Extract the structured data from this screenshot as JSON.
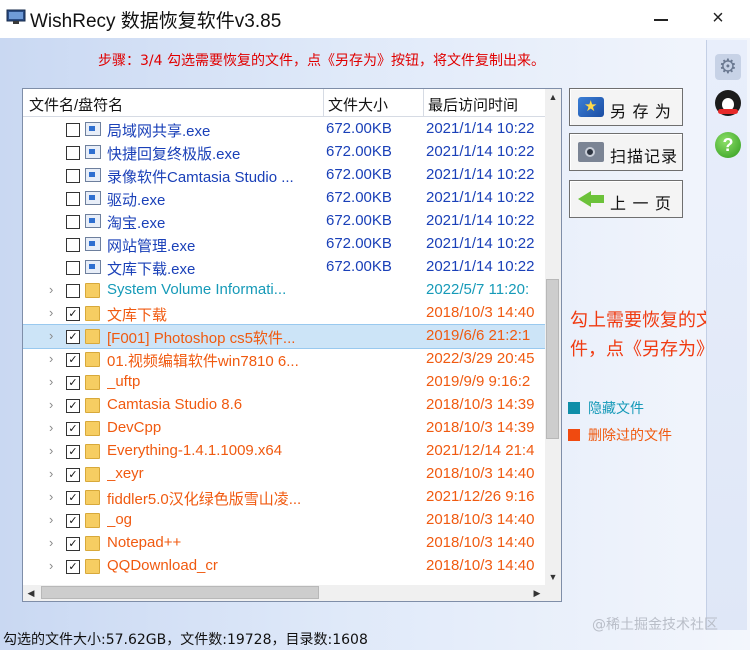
{
  "window": {
    "title": "WishRecy 数据恢复软件v3.85",
    "minimize_glyph": "",
    "close_glyph": "×"
  },
  "step_text": "步骤：3/4 勾选需要恢复的文件，点《另存为》按钮，将文件复制出来。",
  "list": {
    "columns": [
      "文件名/盘符名",
      "文件大小",
      "最后访问时间"
    ],
    "rows": [
      {
        "name": "局域网共享.exe",
        "size": "672.00KB",
        "date": "2021/1/14 10:22",
        "type": "file",
        "color": "normal",
        "checked": false,
        "expandable": false
      },
      {
        "name": "快捷回复终极版.exe",
        "size": "672.00KB",
        "date": "2021/1/14 10:22",
        "type": "file",
        "color": "normal",
        "checked": false,
        "expandable": false
      },
      {
        "name": "录像软件Camtasia Studio ...",
        "size": "672.00KB",
        "date": "2021/1/14 10:22",
        "type": "file",
        "color": "normal",
        "checked": false,
        "expandable": false
      },
      {
        "name": "驱动.exe",
        "size": "672.00KB",
        "date": "2021/1/14 10:22",
        "type": "file",
        "color": "normal",
        "checked": false,
        "expandable": false
      },
      {
        "name": "淘宝.exe",
        "size": "672.00KB",
        "date": "2021/1/14 10:22",
        "type": "file",
        "color": "normal",
        "checked": false,
        "expandable": false
      },
      {
        "name": "网站管理.exe",
        "size": "672.00KB",
        "date": "2021/1/14 10:22",
        "type": "file",
        "color": "normal",
        "checked": false,
        "expandable": false
      },
      {
        "name": "文库下载.exe",
        "size": "672.00KB",
        "date": "2021/1/14 10:22",
        "type": "file",
        "color": "normal",
        "checked": false,
        "expandable": false
      },
      {
        "name": "System Volume Informati...",
        "size": "",
        "date": "2022/5/7 11:20:",
        "type": "folder",
        "color": "hidden",
        "checked": false,
        "expandable": true
      },
      {
        "name": "文库下载",
        "size": "",
        "date": "2018/10/3 14:40",
        "type": "folder",
        "color": "deleted",
        "checked": true,
        "expandable": true
      },
      {
        "name": "[F001] Photoshop cs5软件...",
        "size": "",
        "date": "2019/6/6 21:2:1",
        "type": "folder",
        "color": "deleted",
        "checked": true,
        "expandable": true,
        "selected": true
      },
      {
        "name": "01.视频编辑软件win7810 6...",
        "size": "",
        "date": "2022/3/29 20:45",
        "type": "folder",
        "color": "deleted",
        "checked": true,
        "expandable": true
      },
      {
        "name": "_uftp",
        "size": "",
        "date": "2019/9/9 9:16:2",
        "type": "folder",
        "color": "deleted",
        "checked": true,
        "expandable": true
      },
      {
        "name": "Camtasia Studio 8.6",
        "size": "",
        "date": "2018/10/3 14:39",
        "type": "folder",
        "color": "deleted",
        "checked": true,
        "expandable": true
      },
      {
        "name": "DevCpp",
        "size": "",
        "date": "2018/10/3 14:39",
        "type": "folder",
        "color": "deleted",
        "checked": true,
        "expandable": true
      },
      {
        "name": "Everything-1.4.1.1009.x64",
        "size": "",
        "date": "2021/12/14 21:4",
        "type": "folder",
        "color": "deleted",
        "checked": true,
        "expandable": true
      },
      {
        "name": "_xeyr",
        "size": "",
        "date": "2018/10/3 14:40",
        "type": "folder",
        "color": "deleted",
        "checked": true,
        "expandable": true
      },
      {
        "name": "fiddler5.0汉化绿色版雪山凌...",
        "size": "",
        "date": "2021/12/26 9:16",
        "type": "folder",
        "color": "deleted",
        "checked": true,
        "expandable": true
      },
      {
        "name": "_og",
        "size": "",
        "date": "2018/10/3 14:40",
        "type": "folder",
        "color": "deleted",
        "checked": true,
        "expandable": true
      },
      {
        "name": "Notepad++",
        "size": "",
        "date": "2018/10/3 14:40",
        "type": "folder",
        "color": "deleted",
        "checked": true,
        "expandable": true
      },
      {
        "name": "QQDownload_cr",
        "size": "",
        "date": "2018/10/3 14:40",
        "type": "folder",
        "color": "deleted",
        "checked": true,
        "expandable": true
      }
    ]
  },
  "buttons": {
    "save_as": "另 存 为",
    "scan_log": "扫描记录",
    "prev_page": "上 一 页"
  },
  "note": "勾上需要恢复的文件，点《另存为》",
  "legend": {
    "hidden": "隐藏文件",
    "deleted": "删除过的文件"
  },
  "colors": {
    "normal": "#1a40b8",
    "hidden": "#169ab8",
    "deleted": "#f05a10"
  },
  "sidebar_icons": [
    "settings-icon",
    "qq-icon",
    "help-icon"
  ],
  "status": "勾选的文件大小:57.62GB，文件数:19728，目录数:1608",
  "watermark": "@稀土掘金技术社区"
}
